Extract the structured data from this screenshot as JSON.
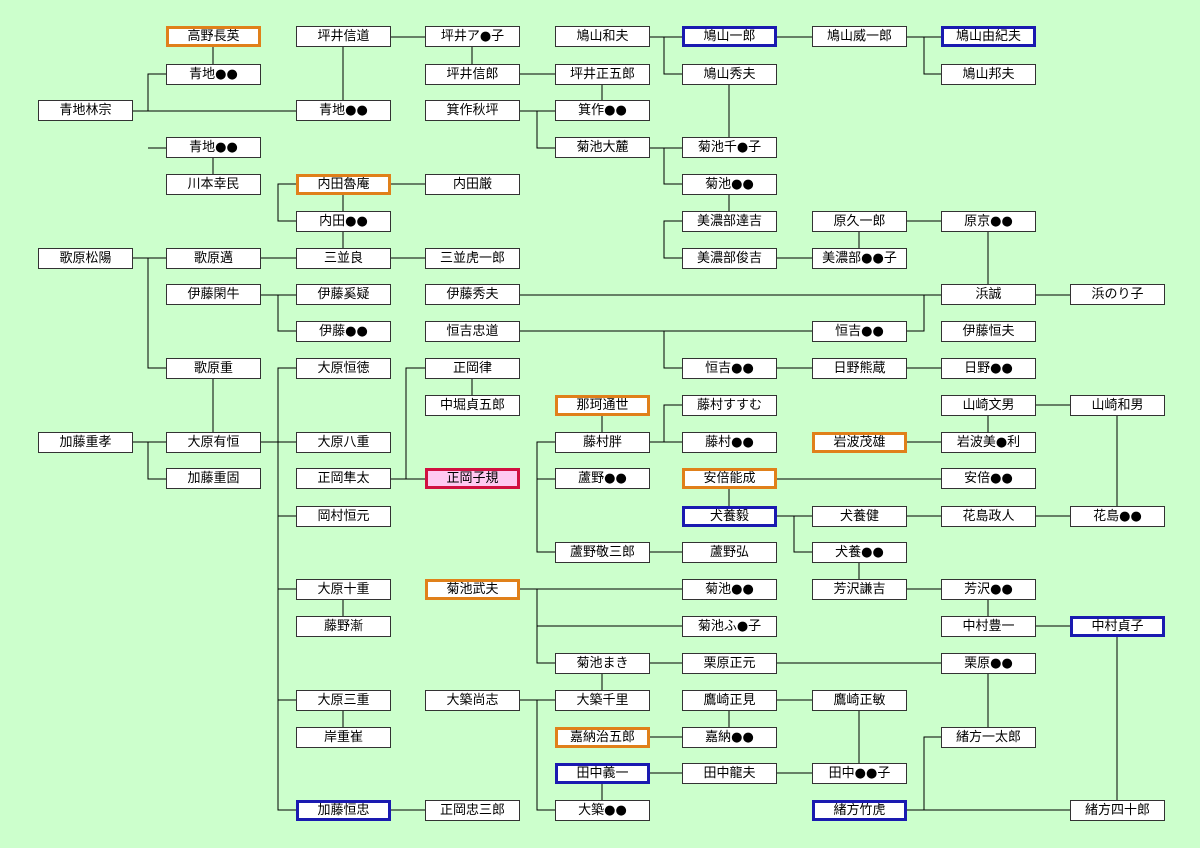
{
  "nodes": [
    {
      "id": "takano",
      "label": "高野長英",
      "style": "orange"
    },
    {
      "id": "aochi1",
      "label": "青地●●",
      "style": "normal"
    },
    {
      "id": "aochi_rinso",
      "label": "青地林宗",
      "style": "normal"
    },
    {
      "id": "aochi3",
      "label": "青地●●",
      "style": "normal"
    },
    {
      "id": "kawamoto",
      "label": "川本幸民",
      "style": "normal"
    },
    {
      "id": "utahara_shoyo",
      "label": "歌原松陽",
      "style": "normal"
    },
    {
      "id": "itou_kengyu",
      "label": "伊藤閑牛",
      "style": "normal"
    },
    {
      "id": "utahara_shige",
      "label": "歌原重",
      "style": "normal"
    },
    {
      "id": "katou_shigetaka",
      "label": "加藤重孝",
      "style": "normal"
    },
    {
      "id": "katou_shigekata",
      "label": "加藤重固",
      "style": "normal"
    },
    {
      "id": "tsuboi_shindo",
      "label": "坪井信道",
      "style": "normal"
    },
    {
      "id": "aochi2",
      "label": "青地●●",
      "style": "normal"
    },
    {
      "id": "uchida_roan",
      "label": "内田魯庵",
      "style": "orange"
    },
    {
      "id": "uchida2",
      "label": "内田●●",
      "style": "normal"
    },
    {
      "id": "utahara_sho",
      "label": "歌原邁",
      "style": "normal"
    },
    {
      "id": "minami_ryo",
      "label": "三並良",
      "style": "normal"
    },
    {
      "id": "itou_keigi",
      "label": "伊藤奚疑",
      "style": "normal"
    },
    {
      "id": "itou2",
      "label": "伊藤●●",
      "style": "normal"
    },
    {
      "id": "ohara_arikazu",
      "label": "大原有恒",
      "style": "normal"
    },
    {
      "id": "ohara_tsunenori",
      "label": "大原恒徳",
      "style": "normal"
    },
    {
      "id": "ohara_hachiju",
      "label": "大原八重",
      "style": "normal"
    },
    {
      "id": "masaoka_hayata",
      "label": "正岡隼太",
      "style": "normal"
    },
    {
      "id": "okamura",
      "label": "岡村恒元",
      "style": "normal"
    },
    {
      "id": "ohara_toe",
      "label": "大原十重",
      "style": "normal"
    },
    {
      "id": "fujino_zen",
      "label": "藤野漸",
      "style": "normal"
    },
    {
      "id": "ohara_mie",
      "label": "大原三重",
      "style": "normal"
    },
    {
      "id": "kishi",
      "label": "岸重崔",
      "style": "normal"
    },
    {
      "id": "katou_tsunetada",
      "label": "加藤恒忠",
      "style": "blue"
    },
    {
      "id": "tsuboi2",
      "label": "坪井ア●子",
      "style": "normal"
    },
    {
      "id": "tsuboi_shinro",
      "label": "坪井信郎",
      "style": "normal"
    },
    {
      "id": "mitsukuri_shuhei",
      "label": "箕作秋坪",
      "style": "normal"
    },
    {
      "id": "uchida_gen",
      "label": "内田厳",
      "style": "normal"
    },
    {
      "id": "minami_toraichiro",
      "label": "三並虎一郎",
      "style": "normal"
    },
    {
      "id": "itou_hideo",
      "label": "伊藤秀夫",
      "style": "normal"
    },
    {
      "id": "tsuneyoshi_tadamichi",
      "label": "恒吉忠道",
      "style": "normal"
    },
    {
      "id": "masaoka_ritsu",
      "label": "正岡律",
      "style": "normal"
    },
    {
      "id": "nakabori",
      "label": "中堀貞五郎",
      "style": "normal"
    },
    {
      "id": "masaoka_shiki",
      "label": "正岡子規",
      "style": "red"
    },
    {
      "id": "kikuchi_takeo",
      "label": "菊池武夫",
      "style": "orange"
    },
    {
      "id": "daichiku_takashi",
      "label": "大築尚志",
      "style": "normal"
    },
    {
      "id": "masaoka_chusaburo",
      "label": "正岡忠三郎",
      "style": "normal"
    },
    {
      "id": "hatoyama_kazuo",
      "label": "鳩山和夫",
      "style": "normal"
    },
    {
      "id": "tsuboi_shogoro",
      "label": "坪井正五郎",
      "style": "normal"
    },
    {
      "id": "mitsukuri2",
      "label": "箕作●●",
      "style": "normal"
    },
    {
      "id": "kikuchi_dairoku",
      "label": "菊池大麓",
      "style": "normal"
    },
    {
      "id": "naka_michiyo",
      "label": "那珂通世",
      "style": "orange"
    },
    {
      "id": "fujimura_han",
      "label": "藤村胖",
      "style": "normal"
    },
    {
      "id": "ashino2",
      "label": "蘆野●●",
      "style": "normal"
    },
    {
      "id": "ashino_keizaburo",
      "label": "蘆野敬三郎",
      "style": "normal"
    },
    {
      "id": "kikuchi_kaki",
      "label": "菊池まき",
      "style": "normal"
    },
    {
      "id": "daichiku_senri",
      "label": "大築千里",
      "style": "normal"
    },
    {
      "id": "kano_jigoro",
      "label": "嘉納治五郎",
      "style": "orange"
    },
    {
      "id": "tanaka_giichi",
      "label": "田中義一",
      "style": "blue"
    },
    {
      "id": "daichiku2",
      "label": "大築●●",
      "style": "normal"
    },
    {
      "id": "hatoyama_ichiro",
      "label": "鳩山一郎",
      "style": "blue"
    },
    {
      "id": "hatoyama_hideo",
      "label": "鳩山秀夫",
      "style": "normal"
    },
    {
      "id": "kikuchi_k1",
      "label": "菊池千●子",
      "style": "normal"
    },
    {
      "id": "kikuchi_k2",
      "label": "菊池●●",
      "style": "normal"
    },
    {
      "id": "minobe_tatsukichi",
      "label": "美濃部達吉",
      "style": "normal"
    },
    {
      "id": "minobe_toshikichi",
      "label": "美濃部俊吉",
      "style": "normal"
    },
    {
      "id": "tsuneyoshi3",
      "label": "恒吉●●",
      "style": "normal"
    },
    {
      "id": "fujimura_susumu",
      "label": "藤村すすむ",
      "style": "normal"
    },
    {
      "id": "fujimura2",
      "label": "藤村●●",
      "style": "normal"
    },
    {
      "id": "abe_yoshishige",
      "label": "安倍能成",
      "style": "orange"
    },
    {
      "id": "inukai_tsuyoshi",
      "label": "犬養毅",
      "style": "blue"
    },
    {
      "id": "ashino_hiroshi",
      "label": "蘆野弘",
      "style": "normal"
    },
    {
      "id": "kikuchi_k3",
      "label": "菊池●●",
      "style": "normal"
    },
    {
      "id": "kikuchi_k4",
      "label": "菊池ふ●子",
      "style": "normal"
    },
    {
      "id": "kurihara_masamoto",
      "label": "栗原正元",
      "style": "normal"
    },
    {
      "id": "takasaki_masami",
      "label": "鷹崎正見",
      "style": "normal"
    },
    {
      "id": "kano2",
      "label": "嘉納●●",
      "style": "normal"
    },
    {
      "id": "tanaka_tatsuo",
      "label": "田中龍夫",
      "style": "normal"
    },
    {
      "id": "hatoyama_iichiro",
      "label": "鳩山威一郎",
      "style": "normal"
    },
    {
      "id": "hara_kyuichiro",
      "label": "原久一郎",
      "style": "normal"
    },
    {
      "id": "minobe3",
      "label": "美濃部●●子",
      "style": "normal"
    },
    {
      "id": "tsuneyoshi2",
      "label": "恒吉●●",
      "style": "normal"
    },
    {
      "id": "hino_kumazo",
      "label": "日野熊蔵",
      "style": "normal"
    },
    {
      "id": "iwanami_shigeo",
      "label": "岩波茂雄",
      "style": "orange"
    },
    {
      "id": "inukai_takeru",
      "label": "犬養健",
      "style": "normal"
    },
    {
      "id": "inukai2",
      "label": "犬養●●",
      "style": "normal"
    },
    {
      "id": "yoshizawa_kenkichi",
      "label": "芳沢謙吉",
      "style": "normal"
    },
    {
      "id": "takasaki_masatoshi",
      "label": "鷹崎正敏",
      "style": "normal"
    },
    {
      "id": "tanaka3",
      "label": "田中●●子",
      "style": "normal"
    },
    {
      "id": "ogata_taketora",
      "label": "緒方竹虎",
      "style": "blue"
    },
    {
      "id": "hatoyama_yukio",
      "label": "鳩山由紀夫",
      "style": "blue"
    },
    {
      "id": "hatoyama_kunio",
      "label": "鳩山邦夫",
      "style": "normal"
    },
    {
      "id": "hara2",
      "label": "原京●●",
      "style": "normal"
    },
    {
      "id": "hama_makoto",
      "label": "浜誠",
      "style": "normal"
    },
    {
      "id": "itou_tsuneo",
      "label": "伊藤恒夫",
      "style": "normal"
    },
    {
      "id": "hino2",
      "label": "日野●●",
      "style": "normal"
    },
    {
      "id": "yamazaki_fumio",
      "label": "山崎文男",
      "style": "normal"
    },
    {
      "id": "iwanami2",
      "label": "岩波美●利",
      "style": "normal"
    },
    {
      "id": "abe2",
      "label": "安倍●●",
      "style": "normal"
    },
    {
      "id": "hanashima_masato",
      "label": "花島政人",
      "style": "normal"
    },
    {
      "id": "yoshizawa2",
      "label": "芳沢●●",
      "style": "normal"
    },
    {
      "id": "nakamura_toyokazu",
      "label": "中村豊一",
      "style": "normal"
    },
    {
      "id": "kurihara2",
      "label": "栗原●●",
      "style": "normal"
    },
    {
      "id": "ogata_ichitaro",
      "label": "緒方一太郎",
      "style": "normal"
    },
    {
      "id": "hama_noriko",
      "label": "浜のり子",
      "style": "normal"
    },
    {
      "id": "yamazaki_kazuo",
      "label": "山崎和男",
      "style": "normal"
    },
    {
      "id": "hanashima2",
      "label": "花島●●",
      "style": "normal"
    },
    {
      "id": "nakamura_sadako",
      "label": "中村貞子",
      "style": "blue"
    },
    {
      "id": "ogata_shijuro",
      "label": "緒方四十郎",
      "style": "normal"
    }
  ]
}
